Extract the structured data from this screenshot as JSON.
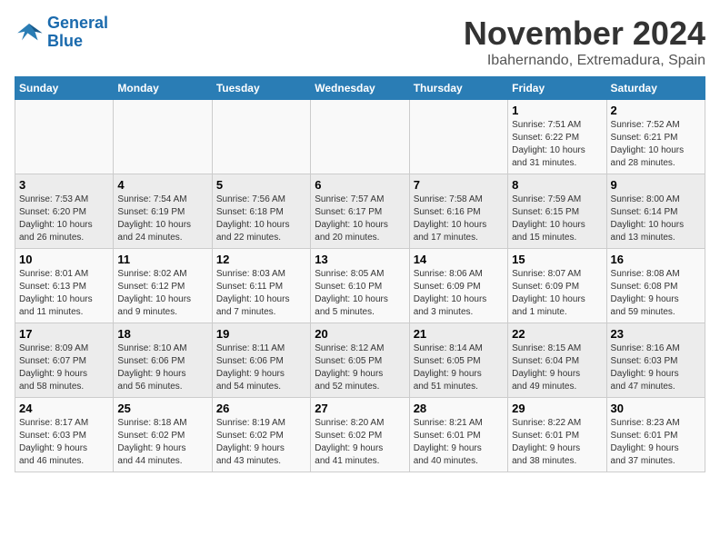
{
  "logo": {
    "line1": "General",
    "line2": "Blue"
  },
  "title": "November 2024",
  "subtitle": "Ibahernando, Extremadura, Spain",
  "weekdays": [
    "Sunday",
    "Monday",
    "Tuesday",
    "Wednesday",
    "Thursday",
    "Friday",
    "Saturday"
  ],
  "weeks": [
    [
      {
        "day": "",
        "detail": ""
      },
      {
        "day": "",
        "detail": ""
      },
      {
        "day": "",
        "detail": ""
      },
      {
        "day": "",
        "detail": ""
      },
      {
        "day": "",
        "detail": ""
      },
      {
        "day": "1",
        "detail": "Sunrise: 7:51 AM\nSunset: 6:22 PM\nDaylight: 10 hours\nand 31 minutes."
      },
      {
        "day": "2",
        "detail": "Sunrise: 7:52 AM\nSunset: 6:21 PM\nDaylight: 10 hours\nand 28 minutes."
      }
    ],
    [
      {
        "day": "3",
        "detail": "Sunrise: 7:53 AM\nSunset: 6:20 PM\nDaylight: 10 hours\nand 26 minutes."
      },
      {
        "day": "4",
        "detail": "Sunrise: 7:54 AM\nSunset: 6:19 PM\nDaylight: 10 hours\nand 24 minutes."
      },
      {
        "day": "5",
        "detail": "Sunrise: 7:56 AM\nSunset: 6:18 PM\nDaylight: 10 hours\nand 22 minutes."
      },
      {
        "day": "6",
        "detail": "Sunrise: 7:57 AM\nSunset: 6:17 PM\nDaylight: 10 hours\nand 20 minutes."
      },
      {
        "day": "7",
        "detail": "Sunrise: 7:58 AM\nSunset: 6:16 PM\nDaylight: 10 hours\nand 17 minutes."
      },
      {
        "day": "8",
        "detail": "Sunrise: 7:59 AM\nSunset: 6:15 PM\nDaylight: 10 hours\nand 15 minutes."
      },
      {
        "day": "9",
        "detail": "Sunrise: 8:00 AM\nSunset: 6:14 PM\nDaylight: 10 hours\nand 13 minutes."
      }
    ],
    [
      {
        "day": "10",
        "detail": "Sunrise: 8:01 AM\nSunset: 6:13 PM\nDaylight: 10 hours\nand 11 minutes."
      },
      {
        "day": "11",
        "detail": "Sunrise: 8:02 AM\nSunset: 6:12 PM\nDaylight: 10 hours\nand 9 minutes."
      },
      {
        "day": "12",
        "detail": "Sunrise: 8:03 AM\nSunset: 6:11 PM\nDaylight: 10 hours\nand 7 minutes."
      },
      {
        "day": "13",
        "detail": "Sunrise: 8:05 AM\nSunset: 6:10 PM\nDaylight: 10 hours\nand 5 minutes."
      },
      {
        "day": "14",
        "detail": "Sunrise: 8:06 AM\nSunset: 6:09 PM\nDaylight: 10 hours\nand 3 minutes."
      },
      {
        "day": "15",
        "detail": "Sunrise: 8:07 AM\nSunset: 6:09 PM\nDaylight: 10 hours\nand 1 minute."
      },
      {
        "day": "16",
        "detail": "Sunrise: 8:08 AM\nSunset: 6:08 PM\nDaylight: 9 hours\nand 59 minutes."
      }
    ],
    [
      {
        "day": "17",
        "detail": "Sunrise: 8:09 AM\nSunset: 6:07 PM\nDaylight: 9 hours\nand 58 minutes."
      },
      {
        "day": "18",
        "detail": "Sunrise: 8:10 AM\nSunset: 6:06 PM\nDaylight: 9 hours\nand 56 minutes."
      },
      {
        "day": "19",
        "detail": "Sunrise: 8:11 AM\nSunset: 6:06 PM\nDaylight: 9 hours\nand 54 minutes."
      },
      {
        "day": "20",
        "detail": "Sunrise: 8:12 AM\nSunset: 6:05 PM\nDaylight: 9 hours\nand 52 minutes."
      },
      {
        "day": "21",
        "detail": "Sunrise: 8:14 AM\nSunset: 6:05 PM\nDaylight: 9 hours\nand 51 minutes."
      },
      {
        "day": "22",
        "detail": "Sunrise: 8:15 AM\nSunset: 6:04 PM\nDaylight: 9 hours\nand 49 minutes."
      },
      {
        "day": "23",
        "detail": "Sunrise: 8:16 AM\nSunset: 6:03 PM\nDaylight: 9 hours\nand 47 minutes."
      }
    ],
    [
      {
        "day": "24",
        "detail": "Sunrise: 8:17 AM\nSunset: 6:03 PM\nDaylight: 9 hours\nand 46 minutes."
      },
      {
        "day": "25",
        "detail": "Sunrise: 8:18 AM\nSunset: 6:02 PM\nDaylight: 9 hours\nand 44 minutes."
      },
      {
        "day": "26",
        "detail": "Sunrise: 8:19 AM\nSunset: 6:02 PM\nDaylight: 9 hours\nand 43 minutes."
      },
      {
        "day": "27",
        "detail": "Sunrise: 8:20 AM\nSunset: 6:02 PM\nDaylight: 9 hours\nand 41 minutes."
      },
      {
        "day": "28",
        "detail": "Sunrise: 8:21 AM\nSunset: 6:01 PM\nDaylight: 9 hours\nand 40 minutes."
      },
      {
        "day": "29",
        "detail": "Sunrise: 8:22 AM\nSunset: 6:01 PM\nDaylight: 9 hours\nand 38 minutes."
      },
      {
        "day": "30",
        "detail": "Sunrise: 8:23 AM\nSunset: 6:01 PM\nDaylight: 9 hours\nand 37 minutes."
      }
    ]
  ]
}
